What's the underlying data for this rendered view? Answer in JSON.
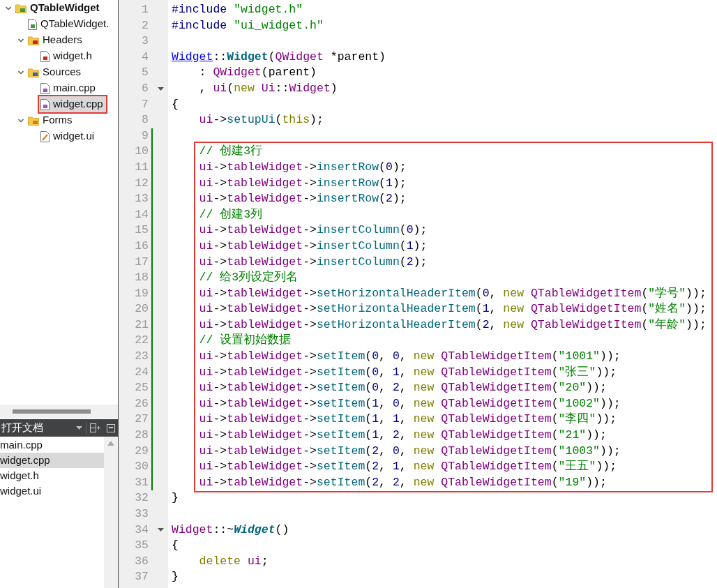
{
  "project_tree": [
    {
      "label": "QTableWidget",
      "kind": "project",
      "expanded": true,
      "selected": false,
      "boxed": false,
      "children": [
        {
          "label": "QTableWidget.",
          "kind": "pro",
          "selected": false,
          "boxed": false
        },
        {
          "label": "Headers",
          "kind": "headers",
          "expanded": true,
          "selected": false,
          "boxed": false,
          "children": [
            {
              "label": "widget.h",
              "kind": "header",
              "selected": false,
              "boxed": false
            }
          ]
        },
        {
          "label": "Sources",
          "kind": "sources",
          "expanded": true,
          "selected": false,
          "boxed": false,
          "children": [
            {
              "label": "main.cpp",
              "kind": "source",
              "selected": false,
              "boxed": false
            },
            {
              "label": "widget.cpp",
              "kind": "source",
              "selected": true,
              "boxed": true
            }
          ]
        },
        {
          "label": "Forms",
          "kind": "forms",
          "expanded": true,
          "selected": false,
          "boxed": false,
          "children": [
            {
              "label": "widget.ui",
              "kind": "form",
              "selected": false,
              "boxed": false
            }
          ]
        }
      ]
    }
  ],
  "open_documents": {
    "title": "打开文档",
    "items": [
      {
        "label": "main.cpp",
        "selected": false
      },
      {
        "label": "widget.cpp",
        "selected": true
      },
      {
        "label": "widget.h",
        "selected": false
      },
      {
        "label": "widget.ui",
        "selected": false
      }
    ]
  },
  "editor": {
    "lines": [
      {
        "number": "1",
        "fold": false,
        "modified": false,
        "boxed": false,
        "tokens": [
          {
            "text": "#include ",
            "kind": "preproc"
          },
          {
            "text": "\"widget.h\"",
            "kind": "string"
          }
        ]
      },
      {
        "number": "2",
        "fold": false,
        "modified": false,
        "boxed": false,
        "tokens": [
          {
            "text": "#include ",
            "kind": "preproc"
          },
          {
            "text": "\"ui_widget.h\"",
            "kind": "string"
          }
        ]
      },
      {
        "number": "3",
        "fold": false,
        "modified": false,
        "boxed": false
      },
      {
        "number": "4",
        "fold": false,
        "modified": false,
        "boxed": false,
        "tokens": [
          {
            "text": "Widget",
            "kind": "link"
          },
          {
            "text": "::",
            "kind": "plain"
          },
          {
            "text": "Widget",
            "kind": "definition"
          },
          {
            "text": "(",
            "kind": "plain"
          },
          {
            "text": "QWidget",
            "kind": "type"
          },
          {
            "text": " *parent)",
            "kind": "plain"
          }
        ]
      },
      {
        "number": "5",
        "fold": false,
        "modified": false,
        "boxed": false,
        "tokens": [
          {
            "text": "    : ",
            "kind": "plain"
          },
          {
            "text": "QWidget",
            "kind": "type"
          },
          {
            "text": "(parent)",
            "kind": "plain"
          }
        ]
      },
      {
        "number": "6",
        "fold": true,
        "modified": false,
        "boxed": false,
        "tokens": [
          {
            "text": "    , ",
            "kind": "plain"
          },
          {
            "text": "ui",
            "kind": "type"
          },
          {
            "text": "(",
            "kind": "plain"
          },
          {
            "text": "new ",
            "kind": "keyword"
          },
          {
            "text": "Ui",
            "kind": "type"
          },
          {
            "text": "::",
            "kind": "plain"
          },
          {
            "text": "Widget",
            "kind": "type"
          },
          {
            "text": ")",
            "kind": "plain"
          }
        ]
      },
      {
        "number": "7",
        "fold": false,
        "modified": false,
        "boxed": false,
        "tokens": [
          {
            "text": "{",
            "kind": "plain"
          }
        ]
      },
      {
        "number": "8",
        "fold": false,
        "modified": false,
        "boxed": false,
        "tokens": [
          {
            "text": "    ui",
            "kind": "type"
          },
          {
            "text": "->",
            "kind": "plain"
          },
          {
            "text": "setupUi",
            "kind": "function"
          },
          {
            "text": "(",
            "kind": "plain"
          },
          {
            "text": "this",
            "kind": "keyword"
          },
          {
            "text": ");",
            "kind": "plain"
          }
        ]
      },
      {
        "number": "9",
        "fold": false,
        "modified": true,
        "boxed": false
      },
      {
        "number": "10",
        "fold": false,
        "modified": true,
        "boxed": true,
        "tokens": [
          {
            "text": "    // 创建3行",
            "kind": "comment"
          }
        ]
      },
      {
        "number": "11",
        "fold": false,
        "modified": true,
        "boxed": true,
        "tokens": [
          {
            "text": "    ui",
            "kind": "type"
          },
          {
            "text": "->",
            "kind": "plain"
          },
          {
            "text": "tableWidget",
            "kind": "type"
          },
          {
            "text": "->",
            "kind": "plain"
          },
          {
            "text": "insertRow",
            "kind": "function"
          },
          {
            "text": "(",
            "kind": "plain"
          },
          {
            "text": "0",
            "kind": "number"
          },
          {
            "text": ");",
            "kind": "plain"
          }
        ]
      },
      {
        "number": "12",
        "fold": false,
        "modified": true,
        "boxed": true,
        "tokens": [
          {
            "text": "    ui",
            "kind": "type"
          },
          {
            "text": "->",
            "kind": "plain"
          },
          {
            "text": "tableWidget",
            "kind": "type"
          },
          {
            "text": "->",
            "kind": "plain"
          },
          {
            "text": "insertRow",
            "kind": "function"
          },
          {
            "text": "(",
            "kind": "plain"
          },
          {
            "text": "1",
            "kind": "number"
          },
          {
            "text": ");",
            "kind": "plain"
          }
        ]
      },
      {
        "number": "13",
        "fold": false,
        "modified": true,
        "boxed": true,
        "tokens": [
          {
            "text": "    ui",
            "kind": "type"
          },
          {
            "text": "->",
            "kind": "plain"
          },
          {
            "text": "tableWidget",
            "kind": "type"
          },
          {
            "text": "->",
            "kind": "plain"
          },
          {
            "text": "insertRow",
            "kind": "function"
          },
          {
            "text": "(",
            "kind": "plain"
          },
          {
            "text": "2",
            "kind": "number"
          },
          {
            "text": ");",
            "kind": "plain"
          }
        ]
      },
      {
        "number": "14",
        "fold": false,
        "modified": true,
        "boxed": true,
        "tokens": [
          {
            "text": "    // 创建3列",
            "kind": "comment"
          }
        ]
      },
      {
        "number": "15",
        "fold": false,
        "modified": true,
        "boxed": true,
        "tokens": [
          {
            "text": "    ui",
            "kind": "type"
          },
          {
            "text": "->",
            "kind": "plain"
          },
          {
            "text": "tableWidget",
            "kind": "type"
          },
          {
            "text": "->",
            "kind": "plain"
          },
          {
            "text": "insertColumn",
            "kind": "function"
          },
          {
            "text": "(",
            "kind": "plain"
          },
          {
            "text": "0",
            "kind": "number"
          },
          {
            "text": ");",
            "kind": "plain"
          }
        ]
      },
      {
        "number": "16",
        "fold": false,
        "modified": true,
        "boxed": true,
        "tokens": [
          {
            "text": "    ui",
            "kind": "type"
          },
          {
            "text": "->",
            "kind": "plain"
          },
          {
            "text": "tableWidget",
            "kind": "type"
          },
          {
            "text": "->",
            "kind": "plain"
          },
          {
            "text": "insertColumn",
            "kind": "function"
          },
          {
            "text": "(",
            "kind": "plain"
          },
          {
            "text": "1",
            "kind": "number"
          },
          {
            "text": ");",
            "kind": "plain"
          }
        ]
      },
      {
        "number": "17",
        "fold": false,
        "modified": true,
        "boxed": true,
        "tokens": [
          {
            "text": "    ui",
            "kind": "type"
          },
          {
            "text": "->",
            "kind": "plain"
          },
          {
            "text": "tableWidget",
            "kind": "type"
          },
          {
            "text": "->",
            "kind": "plain"
          },
          {
            "text": "insertColumn",
            "kind": "function"
          },
          {
            "text": "(",
            "kind": "plain"
          },
          {
            "text": "2",
            "kind": "number"
          },
          {
            "text": ");",
            "kind": "plain"
          }
        ]
      },
      {
        "number": "18",
        "fold": false,
        "modified": true,
        "boxed": true,
        "tokens": [
          {
            "text": "    // 给3列设定列名",
            "kind": "comment"
          }
        ]
      },
      {
        "number": "19",
        "fold": false,
        "modified": true,
        "boxed": true,
        "tokens": [
          {
            "text": "    ui",
            "kind": "type"
          },
          {
            "text": "->",
            "kind": "plain"
          },
          {
            "text": "tableWidget",
            "kind": "type"
          },
          {
            "text": "->",
            "kind": "plain"
          },
          {
            "text": "setHorizontalHeaderItem",
            "kind": "function"
          },
          {
            "text": "(",
            "kind": "plain"
          },
          {
            "text": "0",
            "kind": "number"
          },
          {
            "text": ", ",
            "kind": "plain"
          },
          {
            "text": "new ",
            "kind": "keyword"
          },
          {
            "text": "QTableWidgetItem",
            "kind": "type"
          },
          {
            "text": "(",
            "kind": "plain"
          },
          {
            "text": "\"学号\"",
            "kind": "string"
          },
          {
            "text": "));",
            "kind": "plain"
          }
        ]
      },
      {
        "number": "20",
        "fold": false,
        "modified": true,
        "boxed": true,
        "tokens": [
          {
            "text": "    ui",
            "kind": "type"
          },
          {
            "text": "->",
            "kind": "plain"
          },
          {
            "text": "tableWidget",
            "kind": "type"
          },
          {
            "text": "->",
            "kind": "plain"
          },
          {
            "text": "setHorizontalHeaderItem",
            "kind": "function"
          },
          {
            "text": "(",
            "kind": "plain"
          },
          {
            "text": "1",
            "kind": "number"
          },
          {
            "text": ", ",
            "kind": "plain"
          },
          {
            "text": "new ",
            "kind": "keyword"
          },
          {
            "text": "QTableWidgetItem",
            "kind": "type"
          },
          {
            "text": "(",
            "kind": "plain"
          },
          {
            "text": "\"姓名\"",
            "kind": "string"
          },
          {
            "text": "));",
            "kind": "plain"
          }
        ]
      },
      {
        "number": "21",
        "fold": false,
        "modified": true,
        "boxed": true,
        "tokens": [
          {
            "text": "    ui",
            "kind": "type"
          },
          {
            "text": "->",
            "kind": "plain"
          },
          {
            "text": "tableWidget",
            "kind": "type"
          },
          {
            "text": "->",
            "kind": "plain"
          },
          {
            "text": "setHorizontalHeaderItem",
            "kind": "function"
          },
          {
            "text": "(",
            "kind": "plain"
          },
          {
            "text": "2",
            "kind": "number"
          },
          {
            "text": ", ",
            "kind": "plain"
          },
          {
            "text": "new ",
            "kind": "keyword"
          },
          {
            "text": "QTableWidgetItem",
            "kind": "type"
          },
          {
            "text": "(",
            "kind": "plain"
          },
          {
            "text": "\"年龄\"",
            "kind": "string"
          },
          {
            "text": "));",
            "kind": "plain"
          }
        ]
      },
      {
        "number": "22",
        "fold": false,
        "modified": true,
        "boxed": true,
        "tokens": [
          {
            "text": "    // 设置初始数据",
            "kind": "comment"
          }
        ]
      },
      {
        "number": "23",
        "fold": false,
        "modified": true,
        "boxed": true,
        "tokens": [
          {
            "text": "    ui",
            "kind": "type"
          },
          {
            "text": "->",
            "kind": "plain"
          },
          {
            "text": "tableWidget",
            "kind": "type"
          },
          {
            "text": "->",
            "kind": "plain"
          },
          {
            "text": "setItem",
            "kind": "function"
          },
          {
            "text": "(",
            "kind": "plain"
          },
          {
            "text": "0",
            "kind": "number"
          },
          {
            "text": ", ",
            "kind": "plain"
          },
          {
            "text": "0",
            "kind": "number"
          },
          {
            "text": ", ",
            "kind": "plain"
          },
          {
            "text": "new ",
            "kind": "keyword"
          },
          {
            "text": "QTableWidgetItem",
            "kind": "type"
          },
          {
            "text": "(",
            "kind": "plain"
          },
          {
            "text": "\"1001\"",
            "kind": "string"
          },
          {
            "text": "));",
            "kind": "plain"
          }
        ]
      },
      {
        "number": "24",
        "fold": false,
        "modified": true,
        "boxed": true,
        "tokens": [
          {
            "text": "    ui",
            "kind": "type"
          },
          {
            "text": "->",
            "kind": "plain"
          },
          {
            "text": "tableWidget",
            "kind": "type"
          },
          {
            "text": "->",
            "kind": "plain"
          },
          {
            "text": "setItem",
            "kind": "function"
          },
          {
            "text": "(",
            "kind": "plain"
          },
          {
            "text": "0",
            "kind": "number"
          },
          {
            "text": ", ",
            "kind": "plain"
          },
          {
            "text": "1",
            "kind": "number"
          },
          {
            "text": ", ",
            "kind": "plain"
          },
          {
            "text": "new ",
            "kind": "keyword"
          },
          {
            "text": "QTableWidgetItem",
            "kind": "type"
          },
          {
            "text": "(",
            "kind": "plain"
          },
          {
            "text": "\"张三\"",
            "kind": "string"
          },
          {
            "text": "));",
            "kind": "plain"
          }
        ]
      },
      {
        "number": "25",
        "fold": false,
        "modified": true,
        "boxed": true,
        "tokens": [
          {
            "text": "    ui",
            "kind": "type"
          },
          {
            "text": "->",
            "kind": "plain"
          },
          {
            "text": "tableWidget",
            "kind": "type"
          },
          {
            "text": "->",
            "kind": "plain"
          },
          {
            "text": "setItem",
            "kind": "function"
          },
          {
            "text": "(",
            "kind": "plain"
          },
          {
            "text": "0",
            "kind": "number"
          },
          {
            "text": ", ",
            "kind": "plain"
          },
          {
            "text": "2",
            "kind": "number"
          },
          {
            "text": ", ",
            "kind": "plain"
          },
          {
            "text": "new ",
            "kind": "keyword"
          },
          {
            "text": "QTableWidgetItem",
            "kind": "type"
          },
          {
            "text": "(",
            "kind": "plain"
          },
          {
            "text": "\"20\"",
            "kind": "string"
          },
          {
            "text": "));",
            "kind": "plain"
          }
        ]
      },
      {
        "number": "26",
        "fold": false,
        "modified": true,
        "boxed": true,
        "tokens": [
          {
            "text": "    ui",
            "kind": "type"
          },
          {
            "text": "->",
            "kind": "plain"
          },
          {
            "text": "tableWidget",
            "kind": "type"
          },
          {
            "text": "->",
            "kind": "plain"
          },
          {
            "text": "setItem",
            "kind": "function"
          },
          {
            "text": "(",
            "kind": "plain"
          },
          {
            "text": "1",
            "kind": "number"
          },
          {
            "text": ", ",
            "kind": "plain"
          },
          {
            "text": "0",
            "kind": "number"
          },
          {
            "text": ", ",
            "kind": "plain"
          },
          {
            "text": "new ",
            "kind": "keyword"
          },
          {
            "text": "QTableWidgetItem",
            "kind": "type"
          },
          {
            "text": "(",
            "kind": "plain"
          },
          {
            "text": "\"1002\"",
            "kind": "string"
          },
          {
            "text": "));",
            "kind": "plain"
          }
        ]
      },
      {
        "number": "27",
        "fold": false,
        "modified": true,
        "boxed": true,
        "tokens": [
          {
            "text": "    ui",
            "kind": "type"
          },
          {
            "text": "->",
            "kind": "plain"
          },
          {
            "text": "tableWidget",
            "kind": "type"
          },
          {
            "text": "->",
            "kind": "plain"
          },
          {
            "text": "setItem",
            "kind": "function"
          },
          {
            "text": "(",
            "kind": "plain"
          },
          {
            "text": "1",
            "kind": "number"
          },
          {
            "text": ", ",
            "kind": "plain"
          },
          {
            "text": "1",
            "kind": "number"
          },
          {
            "text": ", ",
            "kind": "plain"
          },
          {
            "text": "new ",
            "kind": "keyword"
          },
          {
            "text": "QTableWidgetItem",
            "kind": "type"
          },
          {
            "text": "(",
            "kind": "plain"
          },
          {
            "text": "\"李四\"",
            "kind": "string"
          },
          {
            "text": "));",
            "kind": "plain"
          }
        ]
      },
      {
        "number": "28",
        "fold": false,
        "modified": true,
        "boxed": true,
        "tokens": [
          {
            "text": "    ui",
            "kind": "type"
          },
          {
            "text": "->",
            "kind": "plain"
          },
          {
            "text": "tableWidget",
            "kind": "type"
          },
          {
            "text": "->",
            "kind": "plain"
          },
          {
            "text": "setItem",
            "kind": "function"
          },
          {
            "text": "(",
            "kind": "plain"
          },
          {
            "text": "1",
            "kind": "number"
          },
          {
            "text": ", ",
            "kind": "plain"
          },
          {
            "text": "2",
            "kind": "number"
          },
          {
            "text": ", ",
            "kind": "plain"
          },
          {
            "text": "new ",
            "kind": "keyword"
          },
          {
            "text": "QTableWidgetItem",
            "kind": "type"
          },
          {
            "text": "(",
            "kind": "plain"
          },
          {
            "text": "\"21\"",
            "kind": "string"
          },
          {
            "text": "));",
            "kind": "plain"
          }
        ]
      },
      {
        "number": "29",
        "fold": false,
        "modified": true,
        "boxed": true,
        "tokens": [
          {
            "text": "    ui",
            "kind": "type"
          },
          {
            "text": "->",
            "kind": "plain"
          },
          {
            "text": "tableWidget",
            "kind": "type"
          },
          {
            "text": "->",
            "kind": "plain"
          },
          {
            "text": "setItem",
            "kind": "function"
          },
          {
            "text": "(",
            "kind": "plain"
          },
          {
            "text": "2",
            "kind": "number"
          },
          {
            "text": ", ",
            "kind": "plain"
          },
          {
            "text": "0",
            "kind": "number"
          },
          {
            "text": ", ",
            "kind": "plain"
          },
          {
            "text": "new ",
            "kind": "keyword"
          },
          {
            "text": "QTableWidgetItem",
            "kind": "type"
          },
          {
            "text": "(",
            "kind": "plain"
          },
          {
            "text": "\"1003\"",
            "kind": "string"
          },
          {
            "text": "));",
            "kind": "plain"
          }
        ]
      },
      {
        "number": "30",
        "fold": false,
        "modified": true,
        "boxed": true,
        "tokens": [
          {
            "text": "    ui",
            "kind": "type"
          },
          {
            "text": "->",
            "kind": "plain"
          },
          {
            "text": "tableWidget",
            "kind": "type"
          },
          {
            "text": "->",
            "kind": "plain"
          },
          {
            "text": "setItem",
            "kind": "function"
          },
          {
            "text": "(",
            "kind": "plain"
          },
          {
            "text": "2",
            "kind": "number"
          },
          {
            "text": ", ",
            "kind": "plain"
          },
          {
            "text": "1",
            "kind": "number"
          },
          {
            "text": ", ",
            "kind": "plain"
          },
          {
            "text": "new ",
            "kind": "keyword"
          },
          {
            "text": "QTableWidgetItem",
            "kind": "type"
          },
          {
            "text": "(",
            "kind": "plain"
          },
          {
            "text": "\"王五\"",
            "kind": "string"
          },
          {
            "text": "));",
            "kind": "plain"
          }
        ]
      },
      {
        "number": "31",
        "fold": false,
        "modified": true,
        "boxed": true,
        "tokens": [
          {
            "text": "    ui",
            "kind": "type"
          },
          {
            "text": "->",
            "kind": "plain"
          },
          {
            "text": "tableWidget",
            "kind": "type"
          },
          {
            "text": "->",
            "kind": "plain"
          },
          {
            "text": "setItem",
            "kind": "function"
          },
          {
            "text": "(",
            "kind": "plain"
          },
          {
            "text": "2",
            "kind": "number"
          },
          {
            "text": ", ",
            "kind": "plain"
          },
          {
            "text": "2",
            "kind": "number"
          },
          {
            "text": ", ",
            "kind": "plain"
          },
          {
            "text": "new ",
            "kind": "keyword"
          },
          {
            "text": "QTableWidgetItem",
            "kind": "type"
          },
          {
            "text": "(",
            "kind": "plain"
          },
          {
            "text": "\"19\"",
            "kind": "string"
          },
          {
            "text": "));",
            "kind": "plain"
          }
        ]
      },
      {
        "number": "32",
        "fold": false,
        "modified": false,
        "boxed": false,
        "tokens": [
          {
            "text": "}",
            "kind": "plain"
          }
        ]
      },
      {
        "number": "33",
        "fold": false,
        "modified": false,
        "boxed": false
      },
      {
        "number": "34",
        "fold": true,
        "modified": false,
        "boxed": false,
        "tokens": [
          {
            "text": "Widget",
            "kind": "type"
          },
          {
            "text": "::~",
            "kind": "plain"
          },
          {
            "text": "Widget",
            "kind": "destructor"
          },
          {
            "text": "()",
            "kind": "plain"
          }
        ]
      },
      {
        "number": "35",
        "fold": false,
        "modified": false,
        "boxed": false,
        "tokens": [
          {
            "text": "{",
            "kind": "plain"
          }
        ]
      },
      {
        "number": "36",
        "fold": false,
        "modified": false,
        "boxed": false,
        "tokens": [
          {
            "text": "    delete ",
            "kind": "keyword"
          },
          {
            "text": "ui",
            "kind": "type"
          },
          {
            "text": ";",
            "kind": "plain"
          }
        ]
      },
      {
        "number": "37",
        "fold": false,
        "modified": false,
        "boxed": false,
        "tokens": [
          {
            "text": "}",
            "kind": "plain"
          }
        ]
      }
    ]
  }
}
